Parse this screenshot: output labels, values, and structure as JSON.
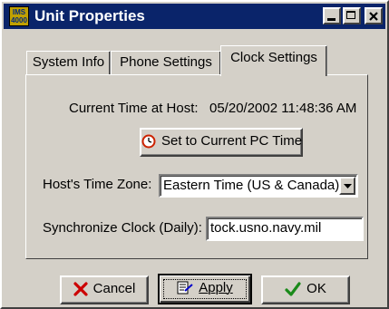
{
  "window": {
    "title": "Unit Properties",
    "app_icon_text": [
      "IMS",
      "4000"
    ]
  },
  "tabs": [
    {
      "label": "System Info",
      "active": false
    },
    {
      "label": "Phone Settings",
      "active": false
    },
    {
      "label": "Clock Settings",
      "active": true
    }
  ],
  "clock": {
    "current_time_label": "Current Time at Host:",
    "current_time_value": "05/20/2002 11:48:36 AM",
    "set_time_button": "Set to Current PC Time",
    "timezone_label": "Host's Time Zone:",
    "timezone_value": "Eastern Time (US & Canada)",
    "sync_label": "Synchronize Clock (Daily):",
    "sync_value": "tock.usno.navy.mil"
  },
  "buttons": {
    "cancel": "Cancel",
    "apply": "Apply",
    "ok": "OK"
  },
  "colors": {
    "titlebar": "#0a246a",
    "face": "#d4d0c8",
    "cancel_icon": "#cc0000",
    "ok_icon": "#1a8a1a",
    "clock_icon": "#cc2200"
  }
}
